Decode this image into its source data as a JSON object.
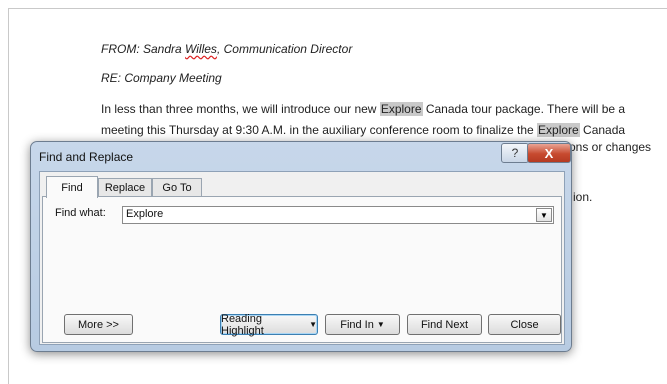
{
  "document": {
    "from_line": "FROM: Sandra Willes, Communication Director",
    "from_prefix": "FROM: Sandra ",
    "from_name": "Willes",
    "from_suffix": ", Communication Director",
    "re_line": "RE: Company Meeting",
    "p1_a": "In less than three months, we will introduce our new ",
    "p1_hl": "Explore",
    "p1_b": " Canada tour package. There will be a",
    "p2_a": "meeting this Thursday at 9:30 A.M. in the auxiliary conference room to finalize the ",
    "p2_hl": "Explore",
    "p2_b": " Canada",
    "p3_partial": "ons or changes",
    "p4_partial": "ion."
  },
  "dialog": {
    "title": "Find and Replace",
    "help_label": "?",
    "close_label": "X",
    "tabs": [
      {
        "label": "Find",
        "active": true
      },
      {
        "label": "Replace",
        "active": false
      },
      {
        "label": "Go To",
        "active": false
      }
    ],
    "find_what_label": "Find what:",
    "find_what_value": "Explore",
    "buttons": {
      "more": "More >>",
      "reading_highlight": "Reading Highlight",
      "find_in": "Find In",
      "find_next": "Find Next",
      "close": "Close"
    }
  }
}
